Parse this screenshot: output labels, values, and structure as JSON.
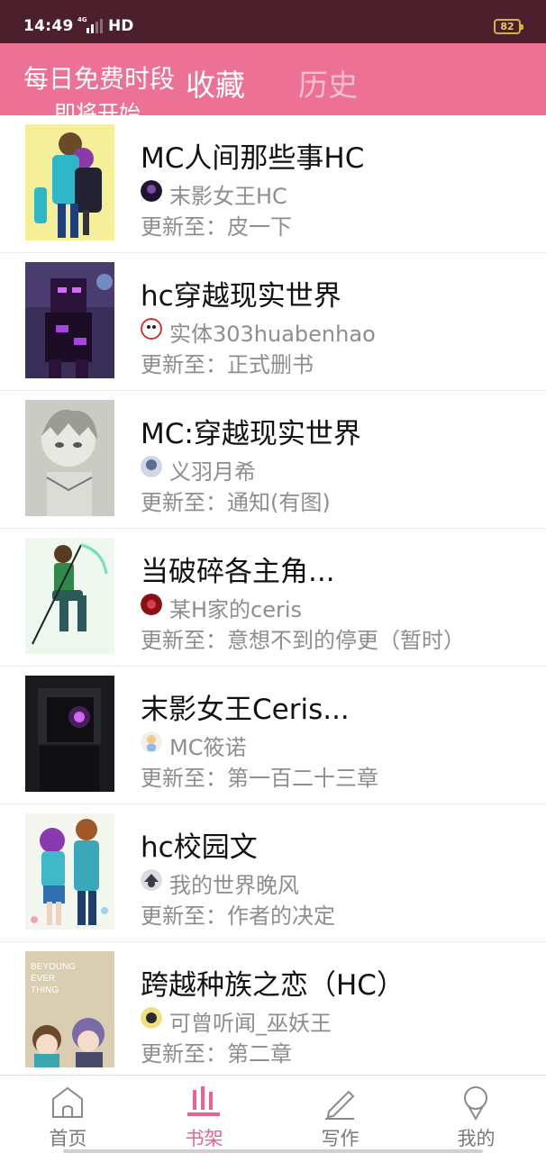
{
  "status_bar": {
    "time": "14:49",
    "network": "4G",
    "hd": "HD",
    "battery": "82"
  },
  "header": {
    "banner_line1": "每日免费时段",
    "banner_line2": "即将开始",
    "tabs": [
      {
        "label": "收藏",
        "active": true
      },
      {
        "label": "历史",
        "active": false
      }
    ]
  },
  "books": [
    {
      "title": "MC人间那些事HC",
      "author": "末影女王HC",
      "update": "更新至：皮一下"
    },
    {
      "title": "hc穿越现实世界",
      "author": "实体303huabenhao",
      "update": "更新至：正式删书"
    },
    {
      "title": "MC:穿越现实世界",
      "author": "义羽月希",
      "update": "更新至：通知(有图)"
    },
    {
      "title": "当破碎各主角...",
      "author": "某H家的ceris",
      "update": "更新至：意想不到的停更（暂时）"
    },
    {
      "title": "末影女王Ceris...",
      "author": "MC筱诺",
      "update": "更新至：第一百二十三章"
    },
    {
      "title": "hc校园文",
      "author": "我的世界晚风",
      "update": "更新至：作者的决定"
    },
    {
      "title": "跨越种族之恋（HC）",
      "author": "可曾听闻_巫妖王",
      "update": "更新至：第二章"
    }
  ],
  "cover_texts": {
    "book7": "BEYOUNG EVER THING"
  },
  "bottom_nav": {
    "items": [
      {
        "label": "首页",
        "icon": "home-icon",
        "active": false
      },
      {
        "label": "书架",
        "icon": "bookshelf-icon",
        "active": true
      },
      {
        "label": "写作",
        "icon": "pencil-icon",
        "active": false
      },
      {
        "label": "我的",
        "icon": "profile-icon",
        "active": false
      }
    ]
  },
  "colors": {
    "header_bg": "#ed7195",
    "status_bg": "#4b1f2c",
    "active_nav": "#ed6090"
  }
}
